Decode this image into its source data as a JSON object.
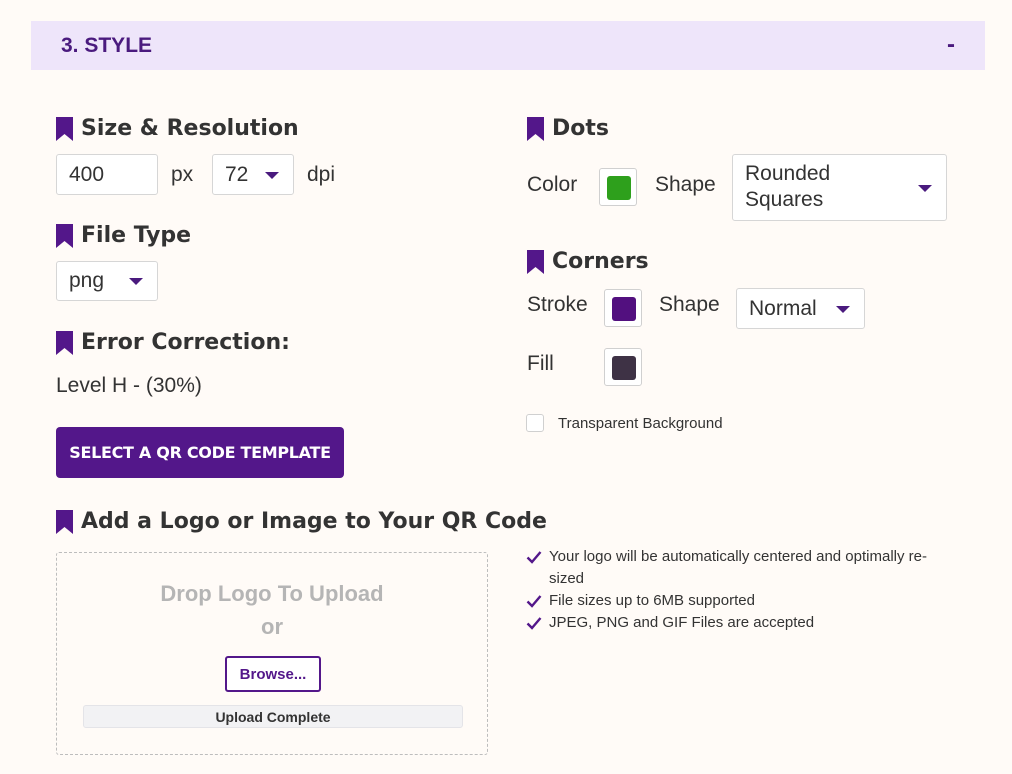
{
  "header": {
    "title": "3. STYLE",
    "toggle": "-"
  },
  "size_resolution": {
    "title": "Size & Resolution",
    "size_value": "400",
    "size_unit": "px",
    "dpi_value": "72",
    "dpi_unit": "dpi"
  },
  "file_type": {
    "title": "File Type",
    "value": "png"
  },
  "error_correction": {
    "title": "Error Correction:",
    "value": "Level H - (30%)"
  },
  "template_button": {
    "label": "SELECT A QR CODE TEMPLATE"
  },
  "dots": {
    "title": "Dots",
    "color_label": "Color",
    "color": "#2ea01c",
    "shape_label": "Shape",
    "shape_line1": "Rounded",
    "shape_line2": "Squares"
  },
  "corners": {
    "title": "Corners",
    "stroke_label": "Stroke",
    "stroke_color": "#52107f",
    "shape_label": "Shape",
    "shape_value": "Normal",
    "fill_label": "Fill",
    "fill_color": "#3e3245"
  },
  "transparent_bg": {
    "label": "Transparent Background",
    "checked": false
  },
  "logo": {
    "title": "Add a Logo or Image to Your QR Code",
    "drop_text": "Drop Logo To Upload",
    "or_text": "or",
    "browse_label": "Browse...",
    "status": "Upload Complete",
    "features": [
      "Your logo will be automatically centered and optimally re-sized",
      "File sizes up to 6MB supported",
      "JPEG, PNG and GIF Files are accepted"
    ]
  },
  "colors": {
    "accent": "#53178a",
    "header_bg": "#eee5fa",
    "page_bg": "#fffbf7"
  },
  "icons": {
    "section": "bookmark-icon",
    "feature": "check-icon",
    "dropdown": "chevron-down-icon"
  }
}
